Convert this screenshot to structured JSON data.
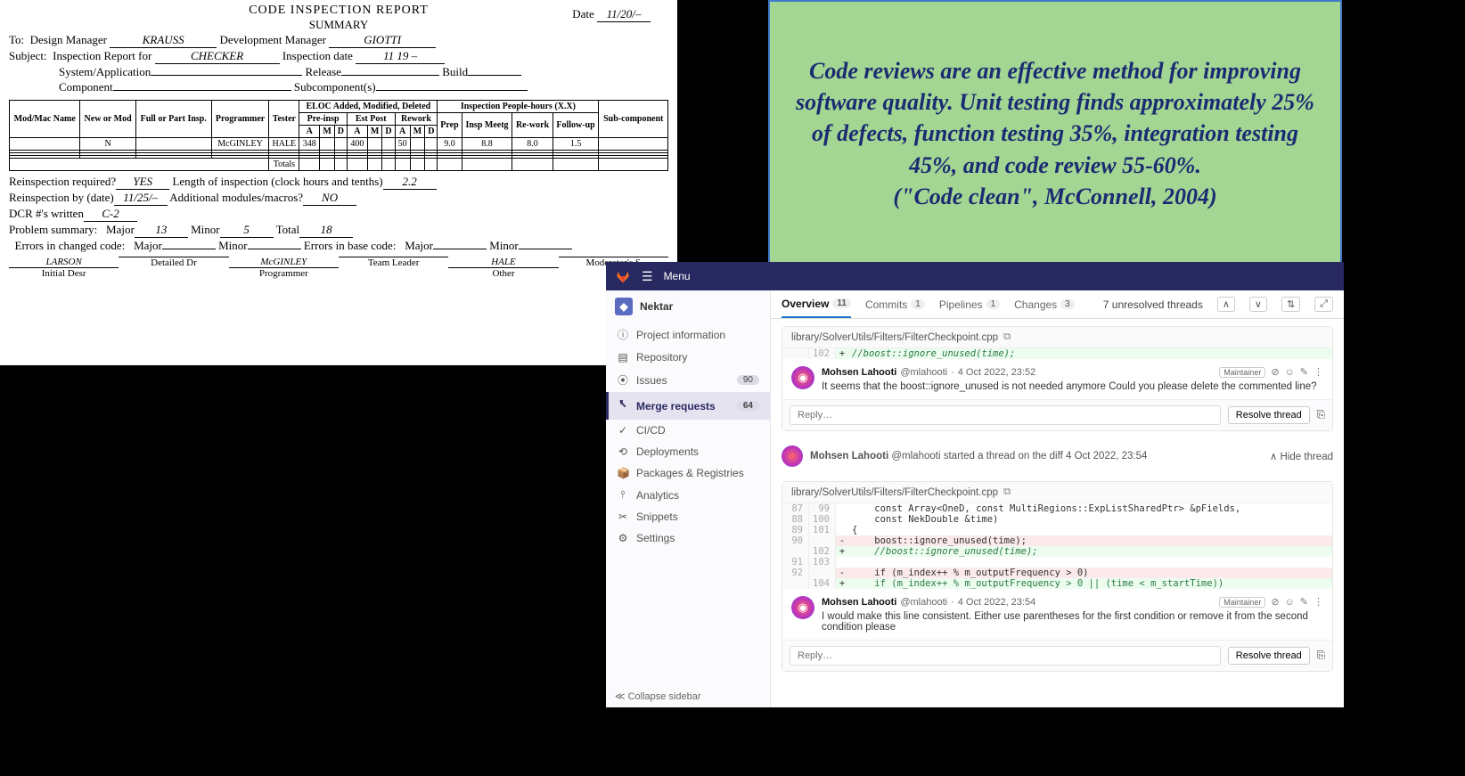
{
  "report": {
    "title": "CODE INSPECTION REPORT",
    "subtitle": "SUMMARY",
    "date_label": "Date",
    "date": "11/20/–",
    "to_label": "To:",
    "to_role": "Design Manager",
    "to_name": "KRAUSS",
    "dev_mgr_label": "Development Manager",
    "dev_mgr": "GIOTTI",
    "subject_label": "Subject:",
    "subject_text1": "Inspection Report for",
    "subject_val": "CHECKER",
    "insp_date_label": "Inspection date",
    "insp_date": "11 19 –",
    "sysapp_label": "System/Application",
    "release_label": "Release",
    "build_label": "Build",
    "component_label": "Component",
    "subcomp_label": "Subcomponent(s)",
    "table": {
      "h_modmac": "Mod/Mac Name",
      "h_newmod": "New or Mod",
      "h_fullpart": "Full or Part Insp.",
      "h_prog": "Programmer",
      "h_tester": "Tester",
      "h_eloc": "ELOC Added, Modified, Deleted",
      "h_preinsp": "Pre-insp",
      "h_estpost": "Est Post",
      "h_rework": "Rework",
      "h_insp": "Inspection People-hours (X.X)",
      "h_prep": "Prep",
      "h_meetg": "Insp Meetg",
      "h_rework2": "Re-work",
      "h_follow": "Follow-up",
      "h_sub": "Sub-component",
      "amd": [
        "A",
        "M",
        "D",
        "A",
        "M",
        "D",
        "A",
        "M",
        "D"
      ],
      "row": {
        "newmod": "N",
        "programmer": "McGINLEY",
        "tester": "HALE",
        "a1": "348",
        "a2": "400",
        "a3": "50",
        "prep": "9.0",
        "meetg": "8.8",
        "rework": "8.0",
        "follow": "1.5"
      },
      "totals_label": "Totals"
    },
    "reinsp_req_label": "Reinspection required?",
    "reinsp_req": "YES",
    "length_label": "Length of inspection (clock hours and tenths)",
    "length": "2.2",
    "reinsp_by_label": "Reinspection by (date)",
    "reinsp_by": "11/25/–",
    "addl_mod_label": "Additional modules/macros?",
    "addl_mod": "NO",
    "dcr_label": "DCR #'s written",
    "dcr": "C-2",
    "prob_sum_label": "Problem summary:",
    "major_label": "Major",
    "major": "13",
    "minor_label": "Minor",
    "minor": "5",
    "total_label": "Total",
    "total": "18",
    "err_changed_label": "Errors in changed code:",
    "err_base_label": "Errors in base code:",
    "roles": [
      {
        "name": "LARSON",
        "role": "Initial Desr"
      },
      {
        "name": "",
        "role": "Detailed Dr"
      },
      {
        "name": "McGINLEY",
        "role": "Programmer"
      },
      {
        "name": "",
        "role": "Team Leader"
      },
      {
        "name": "HALE",
        "role": "Other"
      },
      {
        "name": "",
        "role": "Moderator's S"
      }
    ]
  },
  "quote": {
    "text": "Code reviews are an effective method for improving software quality. Unit testing finds approximately 25% of defects, function testing 35%, integration testing 45%, and code review 55-60%.",
    "cite": "(\"Code clean\", McConnell, 2004)"
  },
  "gitlab": {
    "menu": "Menu",
    "project": "Nektar",
    "sidebar": [
      {
        "icon": "ⓘ",
        "label": "Project information"
      },
      {
        "icon": "▤",
        "label": "Repository"
      },
      {
        "icon": "⦿",
        "label": "Issues",
        "badge": "90"
      },
      {
        "icon": "⭶",
        "label": "Merge requests",
        "badge": "64",
        "active": true
      },
      {
        "icon": "✓",
        "label": "CI/CD"
      },
      {
        "icon": "⟲",
        "label": "Deployments"
      },
      {
        "icon": "📦",
        "label": "Packages & Registries"
      },
      {
        "icon": "⫯",
        "label": "Analytics"
      },
      {
        "icon": "✂",
        "label": "Snippets"
      },
      {
        "icon": "⚙",
        "label": "Settings"
      }
    ],
    "collapse": "Collapse sidebar",
    "tabs": [
      {
        "label": "Overview",
        "count": "11",
        "active": true
      },
      {
        "label": "Commits",
        "count": "1"
      },
      {
        "label": "Pipelines",
        "count": "1"
      },
      {
        "label": "Changes",
        "count": "3"
      }
    ],
    "unresolved": "7 unresolved threads",
    "thread1": {
      "file": "library/SolverUtils/Filters/FilterCheckpoint.cpp",
      "line_no": "102",
      "line_code": "//boost::ignore_unused(time);",
      "author": "Mohsen Lahooti",
      "handle": "@mlahooti",
      "time": "4 Oct 2022, 23:52",
      "badge": "Maintainer",
      "text": "It seems that the boost::ignore_unused is not needed anymore Could you please delete the commented line?",
      "reply_ph": "Reply…",
      "resolve": "Resolve thread"
    },
    "thread2_header": {
      "author": "Mohsen Lahooti",
      "handle": "@mlahooti",
      "text_mid": "started a thread on the diff",
      "time": "4 Oct 2022, 23:54",
      "hide": "Hide thread"
    },
    "thread2": {
      "file": "library/SolverUtils/Filters/FilterCheckpoint.cpp",
      "lines": [
        {
          "old": "87",
          "new": "99",
          "type": "ctx",
          "code": "    const Array<OneD, const MultiRegions::ExpListSharedPtr> &pFields,"
        },
        {
          "old": "88",
          "new": "100",
          "type": "ctx",
          "code": "    const NekDouble &time)"
        },
        {
          "old": "89",
          "new": "101",
          "type": "ctx",
          "code": "{"
        },
        {
          "old": "90",
          "new": "",
          "type": "del",
          "code": "    boost::ignore_unused(time);"
        },
        {
          "old": "",
          "new": "102",
          "type": "add",
          "code": "    //boost::ignore_unused(time);"
        },
        {
          "old": "91",
          "new": "103",
          "type": "ctx",
          "code": ""
        },
        {
          "old": "92",
          "new": "",
          "type": "del",
          "code": "    if (m_index++ % m_outputFrequency > 0)"
        },
        {
          "old": "",
          "new": "104",
          "type": "add",
          "code": "    if (m_index++ % m_outputFrequency > 0 || (time < m_startTime))"
        }
      ],
      "author": "Mohsen Lahooti",
      "handle": "@mlahooti",
      "time": "4 Oct 2022, 23:54",
      "badge": "Maintainer",
      "text": "I would make this line consistent. Either use parentheses for the first condition or remove it from the second condition please",
      "reply_ph": "Reply…",
      "resolve": "Resolve thread"
    }
  }
}
